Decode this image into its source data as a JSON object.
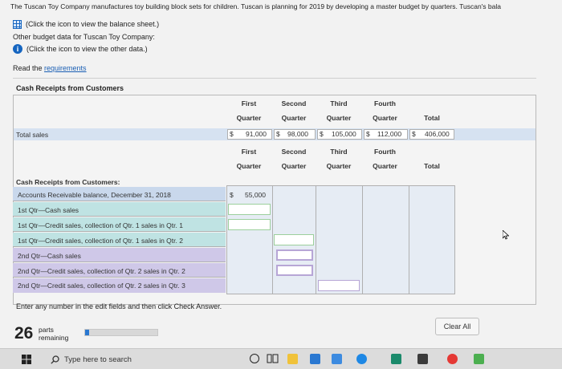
{
  "intro": {
    "line1": "The Tuscan Toy Company manufactures toy building block sets for children. Tuscan is planning for 2019 by developing a master budget by quarters. Tuscan's bala",
    "balance_link": "(Click the icon to view the balance sheet.)",
    "other_label": "Other budget data for Tuscan Toy Company:",
    "other_link": "(Click the icon to view the other data.)",
    "read_prefix": "Read the ",
    "read_link": "requirements"
  },
  "section_title": "Cash Receipts from Customers",
  "headers": {
    "top": [
      "First",
      "Second",
      "Third",
      "Fourth"
    ],
    "bottom": [
      "Quarter",
      "Quarter",
      "Quarter",
      "Quarter"
    ],
    "total": "Total"
  },
  "total_sales": {
    "label": "Total sales",
    "currency": "$",
    "values": [
      "91,000",
      "98,000",
      "105,000",
      "112,000",
      "406,000"
    ]
  },
  "receipts": {
    "heading": "Cash Receipts from Customers:",
    "rows": [
      "Accounts Receivable balance, December 31, 2018",
      "1st Qtr—Cash sales",
      "1st Qtr—Credit sales, collection of Qtr. 1 sales in Qtr. 1",
      "1st Qtr—Credit sales, collection of Qtr. 1 sales in Qtr. 2",
      "2nd Qtr—Cash sales",
      "2nd Qtr—Credit sales, collection of Qtr. 2 sales in Qtr. 2",
      "2nd Qtr—Credit sales, collection of Qtr. 2 sales in Qtr. 3"
    ],
    "ar_currency": "$",
    "ar_value": "55,000"
  },
  "footer": {
    "instruction": "Enter any number in the edit fields and then click Check Answer.",
    "parts_count": "26",
    "parts_label_1": "parts",
    "parts_label_2": "remaining",
    "progress": 0.05,
    "clear_all": "Clear All"
  },
  "taskbar": {
    "search_placeholder": "Type here to search"
  },
  "colors": {
    "blue_band": "#c9d8ec",
    "teal_band": "#bfe3e3",
    "purple_band": "#cfc8e8",
    "link": "#1a5fb4"
  }
}
